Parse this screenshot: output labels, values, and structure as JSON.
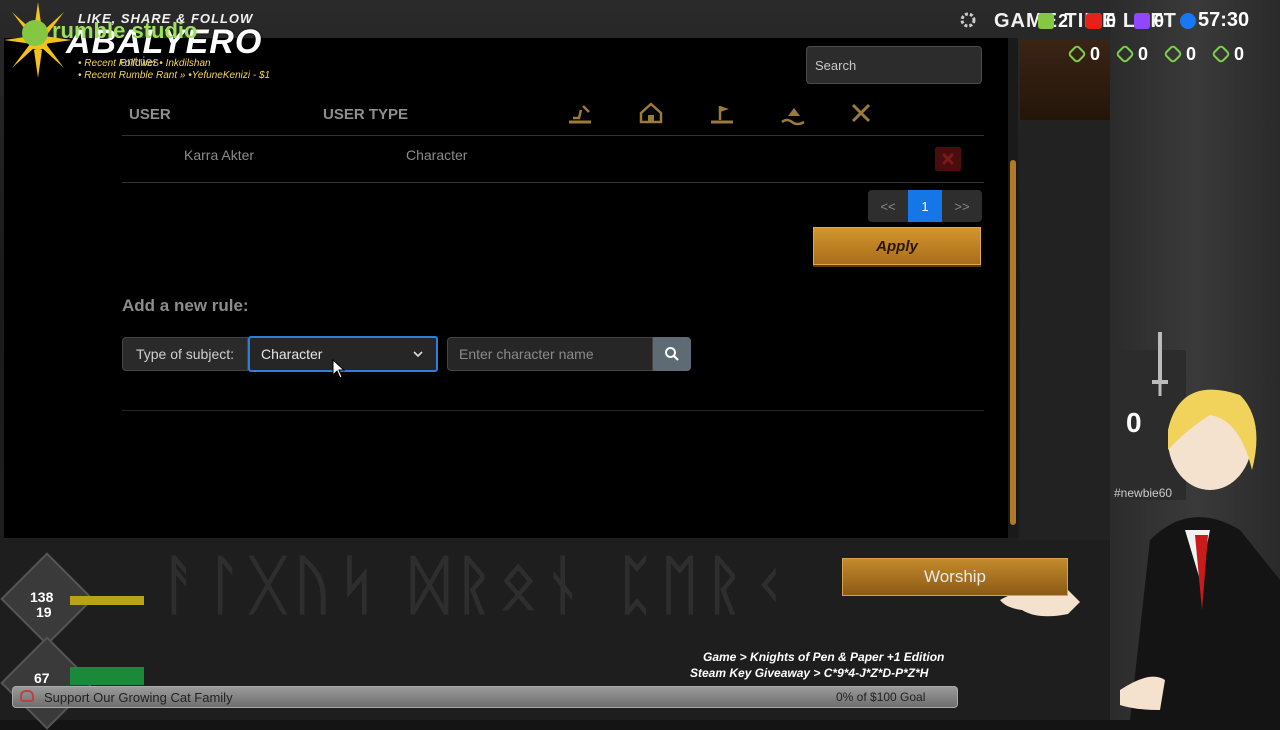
{
  "table": {
    "search_placeholder": "Search",
    "headers": {
      "user": "USER",
      "user_type": "USER TYPE"
    },
    "header_icons": [
      "land-icon",
      "house-icon",
      "field-flag-icon",
      "sea-icon",
      "deny-icon"
    ],
    "rows": [
      {
        "user": "Karra Akter",
        "user_type": "Character"
      }
    ],
    "show_entries_overlay": "entries",
    "pagination": {
      "prev": "<<",
      "current": "1",
      "next": ">>"
    },
    "apply_label": "Apply"
  },
  "new_rule": {
    "title": "Add a new rule:",
    "subject_label": "Type of subject:",
    "subject_value": "Character",
    "name_placeholder": "Enter character name"
  },
  "stream_overlay": {
    "tagline": "LIKE, SHARE & FOLLOW",
    "channel": "ABALYERO",
    "rumble": "rumble studio",
    "recent_follower": "• Recent Follower • Inkdilshan",
    "recent_rant": "• Recent Rumble Rant » •YefuneKenizi - $1",
    "top_bar": "GAME TIME LEFT",
    "clock": "57:30",
    "platform_counts": {
      "rumble": "2",
      "youtube": "0",
      "twitch": "0"
    },
    "link_counts": [
      "0",
      "0",
      "0",
      "0"
    ],
    "rank_value": "0",
    "rank_user": "#newbie60",
    "game_line": "Game > Knights of Pen & Paper +1 Edition",
    "giveaway_line": "Steam Key Giveaway > C*9*4-J*Z*D-P*Z*H",
    "goal_label": "Support Our Growing Cat Family",
    "goal_progress": "0% of $100 Goal"
  },
  "game_hud": {
    "stat_top": "138",
    "stat_sub": "19",
    "stat_bottom": "67",
    "worship_label": "Worship",
    "runes_text": "ᚨᛚᚷᚢᛋ ᛞᚱᛟᚾ ᛈᛖᚱᚲ"
  },
  "colors": {
    "accent_blue": "#1577e6",
    "apply_gold": "#c98a26",
    "scroll_orange": "#b07a2a"
  }
}
